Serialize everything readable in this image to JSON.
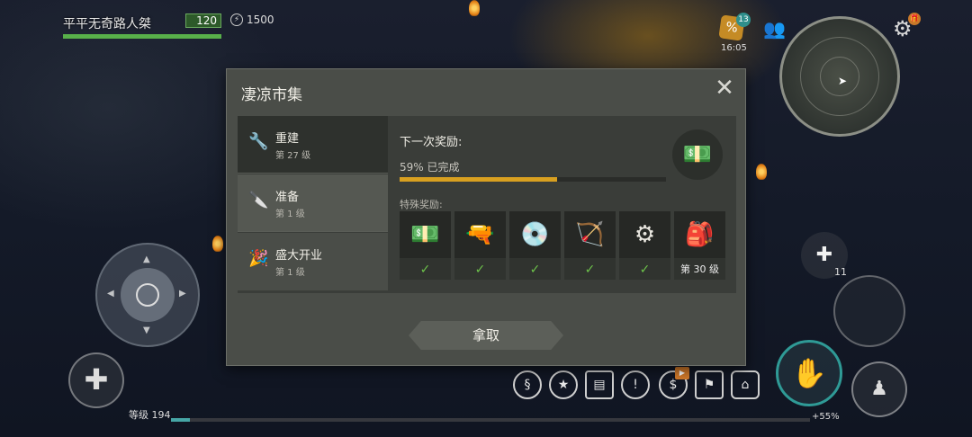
{
  "hud": {
    "player_name": "平平无奇路人桀",
    "health_value": "120",
    "energy_value": "1500",
    "shop_badge": "13",
    "clock": "16:05",
    "level_label": "等级 194",
    "xp_percent": "+55%",
    "consumable_count": "11"
  },
  "dialog": {
    "title": "凄凉市集",
    "tabs": [
      {
        "title": "重建",
        "subtitle": "第 27 级",
        "icon": "wrench-icon"
      },
      {
        "title": "准备",
        "subtitle": "第 1 级",
        "icon": "knife-icon"
      },
      {
        "title": "盛大开业",
        "subtitle": "第 1 级",
        "icon": "party-popper-icon"
      }
    ],
    "next_reward_label": "下一次奖励:",
    "progress_text": "59% 已完成",
    "progress": 0.59,
    "special_rewards_label": "特殊奖励:",
    "special_rewards": [
      {
        "icon": "cash-bundle-icon",
        "status": "✓"
      },
      {
        "icon": "rifle-icon",
        "status": "✓"
      },
      {
        "icon": "vinyl-record-icon",
        "status": "✓"
      },
      {
        "icon": "quiver-icon",
        "status": "✓"
      },
      {
        "icon": "engine-part-icon",
        "status": "✓"
      },
      {
        "icon": "backpack-icon",
        "status": "第 30 级"
      }
    ],
    "collect_button": "拿取"
  }
}
